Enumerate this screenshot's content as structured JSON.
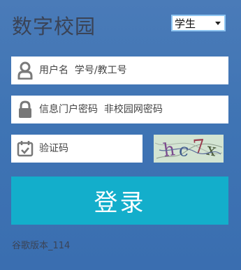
{
  "title": "数字校园",
  "role_select": {
    "value": "学生"
  },
  "username": {
    "placeholder": "用户名  学号/教工号",
    "value": ""
  },
  "password": {
    "placeholder": "信息门户密码  非校园网密码",
    "value": ""
  },
  "captcha_input": {
    "placeholder": "验证码",
    "value": ""
  },
  "captcha_image": {
    "text": "hc7x"
  },
  "login_button": {
    "label": "登录"
  },
  "version": "谷歌版本_114",
  "colors": {
    "accent": "#13aecb",
    "background": "#4074b4",
    "title": "#3a4356"
  },
  "icons": {
    "username": "user-icon",
    "password": "lock-icon",
    "captcha": "calendar-icon"
  }
}
